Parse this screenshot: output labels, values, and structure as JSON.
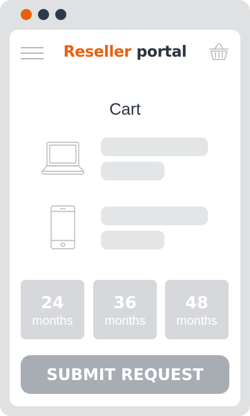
{
  "window_controls": {
    "colors": [
      "#e8600f",
      "#2d3a4a",
      "#2d3a4a"
    ]
  },
  "header": {
    "menu_icon": "hamburger-menu-icon",
    "brand_word_1": "Reseller",
    "brand_word_2": "portal",
    "brand_color_1": "#e8600f",
    "brand_color_2": "#2b3440",
    "cart_icon": "shopping-basket-icon"
  },
  "main": {
    "title": "Cart",
    "items": [
      {
        "icon": "laptop-icon"
      },
      {
        "icon": "smartphone-icon"
      }
    ],
    "terms": [
      {
        "value": "24",
        "unit": "months"
      },
      {
        "value": "36",
        "unit": "months"
      },
      {
        "value": "48",
        "unit": "months"
      }
    ],
    "submit_label": "SUBMIT REQUEST"
  },
  "colors": {
    "frame": "#dfe1e3",
    "placeholder": "#e4e5e7",
    "term_tile": "#d6d8db",
    "submit_button": "#a7adb3"
  }
}
